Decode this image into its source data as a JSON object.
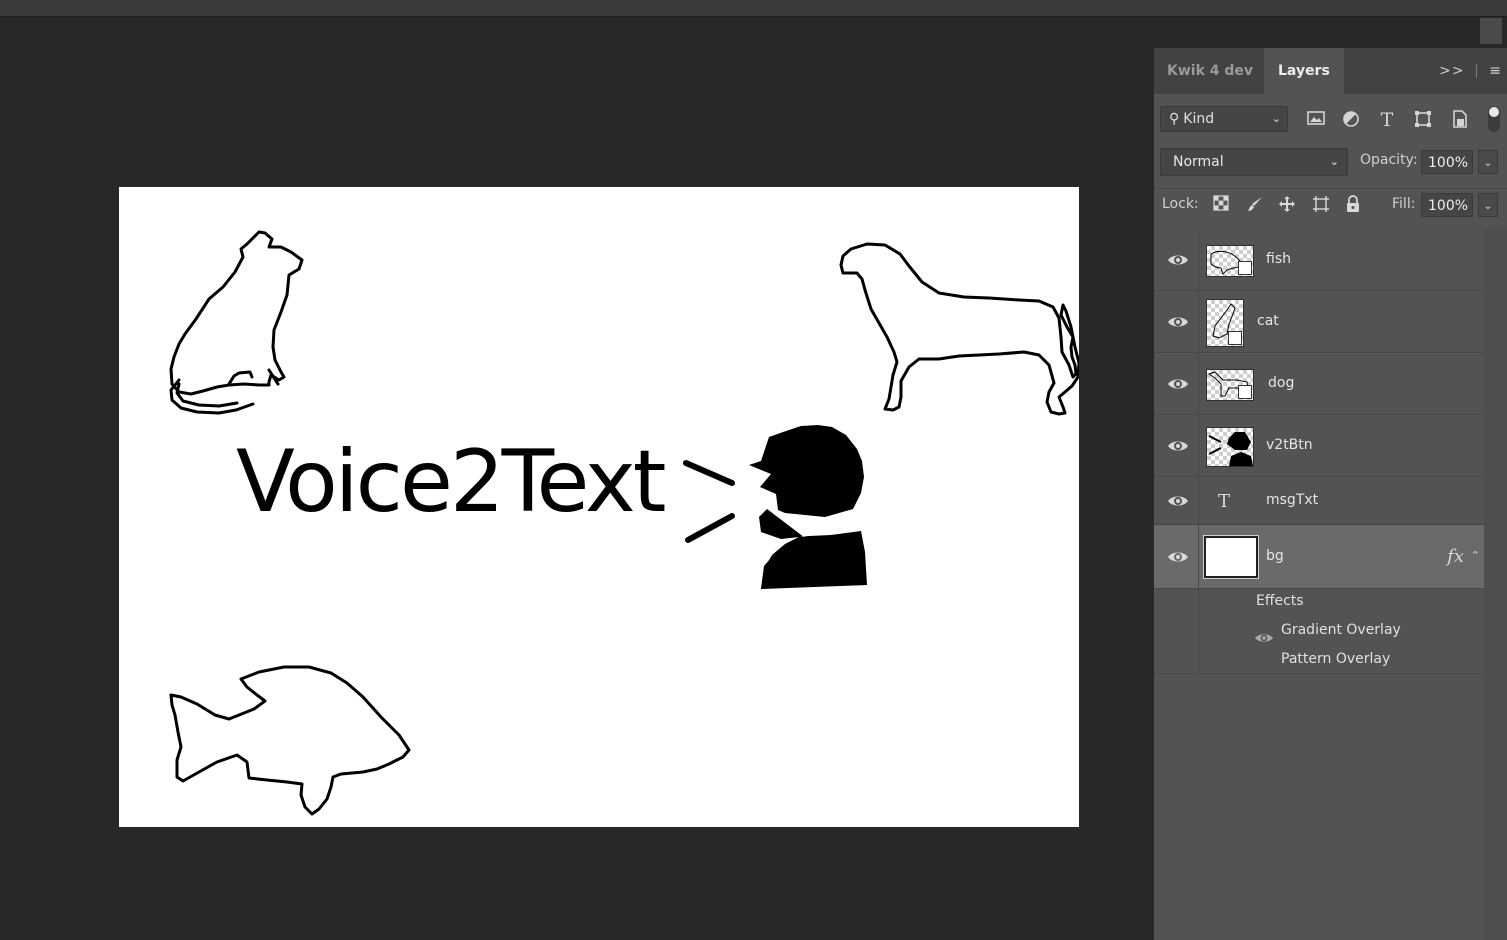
{
  "panel": {
    "tabs": [
      "Kwik 4 dev",
      "Layers"
    ],
    "active_tab": "Layers",
    "menu_icons": [
      "double-chevron-right-icon",
      "panel-menu-icon"
    ]
  },
  "filter": {
    "kind_label": "Kind",
    "icons": [
      "image-filter-icon",
      "adjustment-filter-icon",
      "type-filter-icon",
      "shape-filter-icon",
      "smart-object-filter-icon"
    ]
  },
  "blend": {
    "mode": "Normal",
    "opacity_label": "Opacity:",
    "opacity_value": "100%",
    "lock_label": "Lock:",
    "fill_label": "Fill:",
    "fill_value": "100%"
  },
  "layers": [
    {
      "name": "fish",
      "type": "smart",
      "visible": true
    },
    {
      "name": "cat",
      "type": "smart",
      "visible": true
    },
    {
      "name": "dog",
      "type": "smart",
      "visible": true
    },
    {
      "name": "v2tBtn",
      "type": "pixel",
      "visible": true
    },
    {
      "name": "msgTxt",
      "type": "text",
      "visible": true
    },
    {
      "name": "bg",
      "type": "pixel",
      "visible": true,
      "selected": true,
      "fx": "fx"
    }
  ],
  "effects": {
    "title": "Effects",
    "items": [
      "Gradient Overlay",
      "Pattern Overlay"
    ]
  },
  "canvas": {
    "headline": "Voice2Text"
  }
}
